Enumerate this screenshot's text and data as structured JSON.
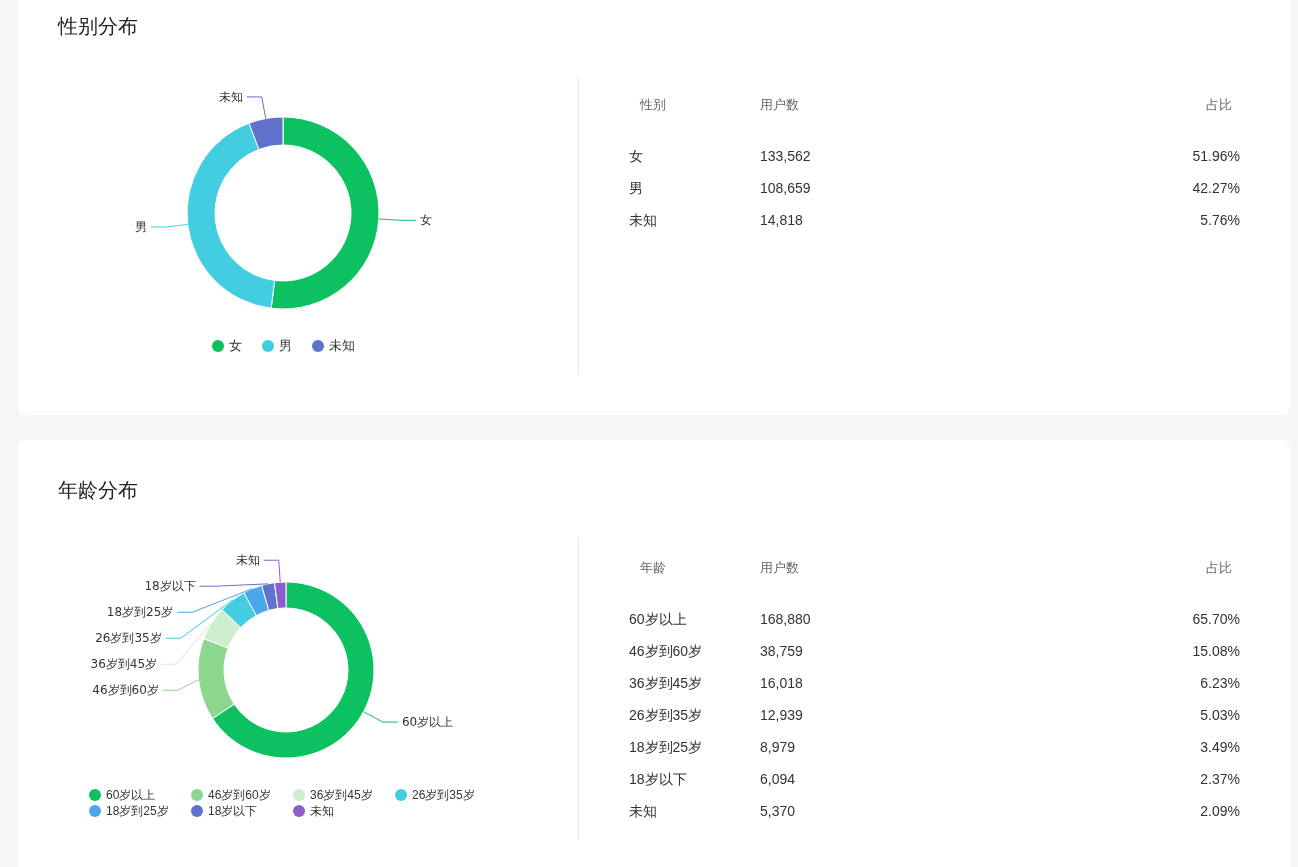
{
  "sections": [
    {
      "title": "性别分布",
      "chart": {
        "legend": [
          {
            "label": "女",
            "color": "#0bc160"
          },
          {
            "label": "男",
            "color": "#43cde0"
          },
          {
            "label": "未知",
            "color": "#5f73cc"
          }
        ],
        "chart_data": {
          "type": "donut",
          "categories": [
            "女",
            "男",
            "未知"
          ],
          "values": [
            51.96,
            42.27,
            5.76
          ]
        }
      },
      "table": {
        "columns": [
          "性别",
          "用户数",
          "占比"
        ],
        "rows": [
          [
            "女",
            "133,562",
            "51.96%"
          ],
          [
            "男",
            "108,659",
            "42.27%"
          ],
          [
            "未知",
            "14,818",
            "5.76%"
          ]
        ]
      }
    },
    {
      "title": "年龄分布",
      "chart": {
        "legend": [
          {
            "label": "60岁以上",
            "color": "#0bc160"
          },
          {
            "label": "46岁到60岁",
            "color": "#8dd68d"
          },
          {
            "label": "36岁到45岁",
            "color": "#cdeecf"
          },
          {
            "label": "26岁到35岁",
            "color": "#43cde0"
          },
          {
            "label": "18岁到25岁",
            "color": "#4aa7ea"
          },
          {
            "label": "18岁以下",
            "color": "#5f73cc"
          },
          {
            "label": "未知",
            "color": "#8e5fcc"
          }
        ],
        "chart_data": {
          "type": "donut",
          "categories": [
            "60岁以上",
            "46岁到60岁",
            "36岁到45岁",
            "26岁到35岁",
            "18岁到25岁",
            "18岁以下",
            "未知"
          ],
          "values": [
            65.7,
            15.08,
            6.23,
            5.03,
            3.49,
            2.37,
            2.09
          ]
        }
      },
      "table": {
        "columns": [
          "年龄",
          "用户数",
          "占比"
        ],
        "rows": [
          [
            "60岁以上",
            "168,880",
            "65.70%"
          ],
          [
            "46岁到60岁",
            "38,759",
            "15.08%"
          ],
          [
            "36岁到45岁",
            "16,018",
            "6.23%"
          ],
          [
            "26岁到35岁",
            "12,939",
            "5.03%"
          ],
          [
            "18岁到25岁",
            "8,979",
            "3.49%"
          ],
          [
            "18岁以下",
            "6,094",
            "2.37%"
          ],
          [
            "未知",
            "5,370",
            "2.09%"
          ]
        ]
      }
    }
  ]
}
